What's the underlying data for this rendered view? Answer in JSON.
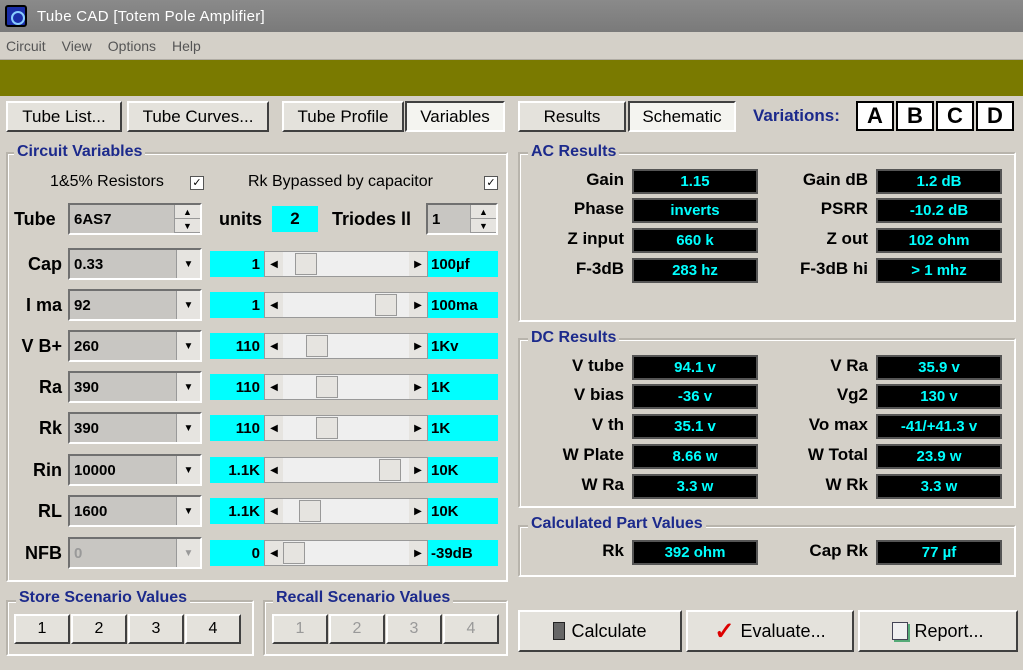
{
  "window": {
    "title": "Tube CAD   [Totem Pole Amplifier]"
  },
  "menu": [
    "Circuit",
    "View",
    "Options",
    "Help"
  ],
  "toolbar": {
    "tube_list": "Tube List...",
    "tube_curves": "Tube Curves...",
    "tube_profile": "Tube Profile",
    "variables": "Variables",
    "results": "Results",
    "schematic": "Schematic",
    "variations_label": "Variations:",
    "variations": [
      "A",
      "B",
      "C",
      "D"
    ]
  },
  "circuit_variables": {
    "title": "Circuit Variables",
    "resistors_label": "1&5% Resistors",
    "resistors_checked": true,
    "bypass_label": "Rk Bypassed by capacitor",
    "bypass_checked": true,
    "tube_label": "Tube",
    "tube_value": "6AS7",
    "units_label": "units",
    "units_value": "2",
    "triodes_label": "Triodes ll",
    "triodes_value": "1",
    "rows": [
      {
        "label": "Cap",
        "value": "0.33",
        "multiplier": "1",
        "max": "100µf",
        "slider_pos": 0.12,
        "disabled": false
      },
      {
        "label": "I ma",
        "value": "92",
        "multiplier": "1",
        "max": "100ma",
        "slider_pos": 0.88,
        "disabled": false
      },
      {
        "label": "V B+",
        "value": "260",
        "multiplier": "110",
        "max": "1Kv",
        "slider_pos": 0.22,
        "disabled": false
      },
      {
        "label": "Ra",
        "value": "390",
        "multiplier": "110",
        "max": "1K",
        "slider_pos": 0.32,
        "disabled": false
      },
      {
        "label": "Rk",
        "value": "390",
        "multiplier": "110",
        "max": "1K",
        "slider_pos": 0.32,
        "disabled": false
      },
      {
        "label": "Rin",
        "value": "10000",
        "multiplier": "1.1K",
        "max": "10K",
        "slider_pos": 0.92,
        "disabled": false
      },
      {
        "label": "RL",
        "value": "1600",
        "multiplier": "1.1K",
        "max": "10K",
        "slider_pos": 0.15,
        "disabled": false
      },
      {
        "label": "NFB",
        "value": "0",
        "multiplier": "0",
        "max": "-39dB",
        "slider_pos": 0.0,
        "disabled": true
      }
    ]
  },
  "store": {
    "title": "Store Scenario Values",
    "buttons": [
      "1",
      "2",
      "3",
      "4"
    ]
  },
  "recall": {
    "title": "Recall Scenario Values",
    "buttons": [
      "1",
      "2",
      "3",
      "4"
    ]
  },
  "ac_results": {
    "title": "AC Results",
    "items": [
      {
        "label": "Gain",
        "value": "1.15"
      },
      {
        "label": "Gain dB",
        "value": "1.2 dB"
      },
      {
        "label": "Phase",
        "value": "inverts"
      },
      {
        "label": "PSRR",
        "value": "-10.2 dB"
      },
      {
        "label": "Z input",
        "value": "660 k"
      },
      {
        "label": "Z out",
        "value": "102 ohm"
      },
      {
        "label": "F-3dB",
        "value": "283 hz"
      },
      {
        "label": "F-3dB hi",
        "value": "> 1 mhz"
      }
    ]
  },
  "dc_results": {
    "title": "DC Results",
    "items": [
      {
        "label": "V tube",
        "value": "94.1 v"
      },
      {
        "label": "V Ra",
        "value": "35.9 v"
      },
      {
        "label": "V bias",
        "value": "-36 v"
      },
      {
        "label": "Vg2",
        "value": "130 v"
      },
      {
        "label": "V th",
        "value": "35.1 v"
      },
      {
        "label": "Vo max",
        "value": "-41/+41.3 v"
      },
      {
        "label": "W Plate",
        "value": "8.66 w"
      },
      {
        "label": "W Total",
        "value": "23.9 w"
      },
      {
        "label": "W Ra",
        "value": "3.3 w"
      },
      {
        "label": "W Rk",
        "value": "3.3 w"
      }
    ]
  },
  "part_values": {
    "title": "Calculated Part Values",
    "items": [
      {
        "label": "Rk",
        "value": "392 ohm"
      },
      {
        "label": "Cap Rk",
        "value": "77 µf"
      }
    ]
  },
  "actions": {
    "calculate": "Calculate",
    "evaluate": "Evaluate...",
    "report": "Report..."
  }
}
